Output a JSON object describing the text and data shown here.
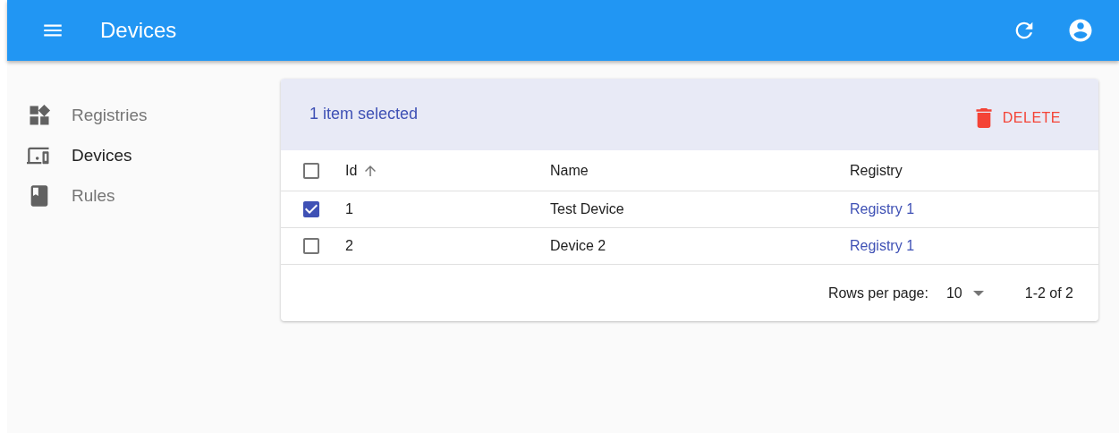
{
  "app_bar": {
    "title": "Devices"
  },
  "sidebar": {
    "items": [
      {
        "label": "Registries",
        "kind": "registries",
        "selected": false
      },
      {
        "label": "Devices",
        "kind": "devices",
        "selected": true
      },
      {
        "label": "Rules",
        "kind": "rules",
        "selected": false
      }
    ]
  },
  "table": {
    "selection_text": "1 item selected",
    "delete_label": "DELETE",
    "all_checked": false,
    "columns": [
      {
        "label": "Id",
        "sorted": true
      },
      {
        "label": "Name",
        "sorted": false
      },
      {
        "label": "Registry",
        "sorted": false
      }
    ],
    "rows": [
      {
        "checked": true,
        "id": "1",
        "name": "Test Device",
        "registry": "Registry 1"
      },
      {
        "checked": false,
        "id": "2",
        "name": "Device 2",
        "registry": "Registry 1"
      }
    ],
    "pagination": {
      "rows_per_page_label": "Rows per page:",
      "rows_per_page": "10",
      "range": "1-2 of 2"
    }
  }
}
